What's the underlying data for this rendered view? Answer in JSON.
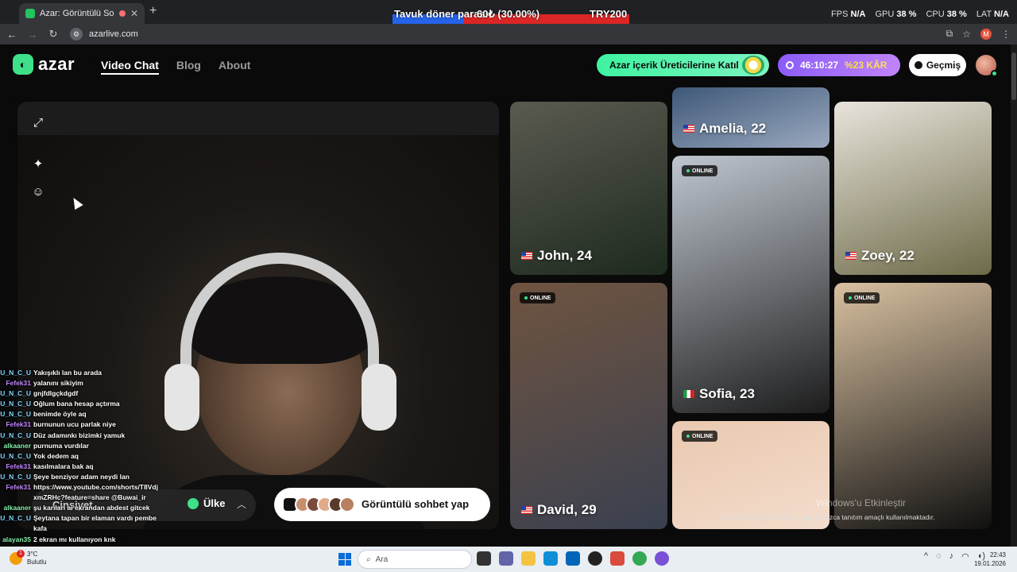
{
  "browser": {
    "tab_title": "Azar: Görüntülü Sohbet & Vide",
    "url": "azarlive.com",
    "perf": {
      "fps_label": "FPS",
      "fps_value": "N/A",
      "gpu_label": "GPU",
      "gpu_value": "38 %",
      "cpu_label": "CPU",
      "cpu_value": "38 %",
      "lat_label": "LAT",
      "lat_value": "N/A"
    },
    "profile_initial": "M"
  },
  "donation_bar": {
    "label": "Tavuk döner parası",
    "current": "60₺ (30.00%)",
    "goal": "TRY200",
    "progress": 0.3
  },
  "header": {
    "logo_text": "azar",
    "nav": [
      "Video Chat",
      "Blog",
      "About"
    ],
    "cta_label": "Azar içerik Üreticilerine Katıl",
    "timer_value": "46:10:27",
    "timer_discount": "%23 KÂR",
    "history_label": "Geçmiş"
  },
  "video_controls": {
    "gender_label": "Cinsiyet",
    "country_label": "Ülke",
    "start_label": "Görüntülü sohbet yap"
  },
  "chat": [
    {
      "user": "U_N_C_U",
      "msg": "Yakışıklı lan bu arada",
      "type": "u"
    },
    {
      "user": "Fefek31",
      "msg": "yalanını sikiyim",
      "type": "f"
    },
    {
      "user": "U_N_C_U",
      "msg": "gnjfdlgçkdgdf",
      "type": "u"
    },
    {
      "user": "U_N_C_U",
      "msg": "Oğlum bana hesap açtırma",
      "type": "u"
    },
    {
      "user": "U_N_C_U",
      "msg": "benimde öyle aq",
      "type": "u"
    },
    {
      "user": "Fefek31",
      "msg": "burnunun ucu parlak niye",
      "type": "f"
    },
    {
      "user": "U_N_C_U",
      "msg": "Düz adamınkı bizimki yamuk",
      "type": "u"
    },
    {
      "user": "alkaaner",
      "msg": "purnuma vurdılar",
      "type": "a"
    },
    {
      "user": "U_N_C_U",
      "msg": "Yok dedem aq",
      "type": "u"
    },
    {
      "user": "Fefek31",
      "msg": "kasılmalara bak aq",
      "type": "f"
    },
    {
      "user": "U_N_C_U",
      "msg": "Şeye benziyor adam neydi lan",
      "type": "u"
    },
    {
      "user": "Fefek31",
      "msg": "https://www.youtube.com/shorts/T8Vdj",
      "type": "f"
    },
    {
      "user": "",
      "msg": "xmZRHc?feature=share @Buwai_ir",
      "type": "u"
    },
    {
      "user": "alkaaner",
      "msg": "şu karıları ai ekrandan abdest gitcek",
      "type": "a"
    },
    {
      "user": "U_N_C_U",
      "msg": "Şeytana tapan bir elaman vardı pembe",
      "type": "u"
    },
    {
      "user": "",
      "msg": "kafa",
      "type": "u"
    },
    {
      "user": "alayan35",
      "msg": "2 ekran mı kullanıyon knk",
      "type": "a"
    }
  ],
  "cards": [
    {
      "name": "Amelia, 22",
      "flag": "us",
      "online": false,
      "colors": [
        "#3f5878",
        "#9aa9bf"
      ]
    },
    {
      "name": "John, 24",
      "flag": "us",
      "online": false,
      "colors": [
        "#5a5a50",
        "#1e2a1e"
      ]
    },
    {
      "name": "Zoey, 22",
      "flag": "us",
      "online": false,
      "colors": [
        "#e8e4dc",
        "#6d6a48"
      ]
    },
    {
      "name": "Sofia, 23",
      "flag": "it",
      "online": true,
      "colors": [
        "#bfc6cf",
        "#1c1c1c"
      ]
    },
    {
      "name": "David, 29",
      "flag": "us",
      "online": true,
      "colors": [
        "#6f5440",
        "#3a4050"
      ]
    },
    {
      "name": "",
      "flag": "us",
      "online": true,
      "colors": [
        "#d8c0a0",
        "#101010"
      ]
    },
    {
      "name": "",
      "flag": "us",
      "online": true,
      "colors": [
        "#e9c9b0",
        "#f3dccc"
      ]
    }
  ],
  "online_label": "ONLINE",
  "disclaimer": "Tüm resimler modellerden olup, yalnızca tanıtım amaçlı kullanılmaktadır.",
  "windows_activate": "Windows'u Etkinleştir",
  "taskbar": {
    "temp": "3°C",
    "weather": "Bulutlu",
    "search_placeholder": "Ara",
    "time": "22:43",
    "date": "19.01.2026"
  },
  "colors": {
    "accent": "#3ee08a",
    "purple": "#8b5cf6"
  }
}
